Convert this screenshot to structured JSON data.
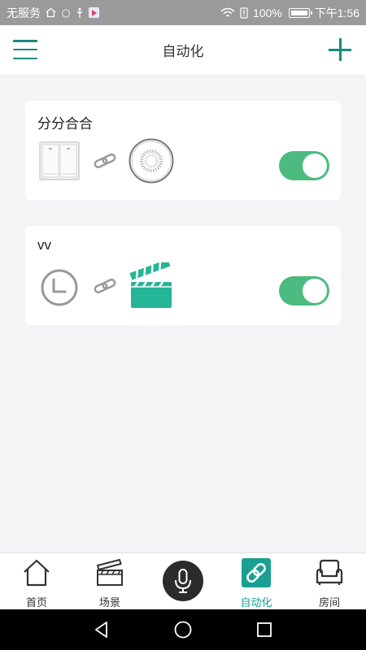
{
  "status_bar": {
    "carrier": "无服务",
    "battery": "100%",
    "time": "下午1:56"
  },
  "header": {
    "title": "自动化",
    "menu_icon": "menu-icon",
    "add_icon": "plus-icon"
  },
  "automations": [
    {
      "name": "分分合合",
      "trigger_icon": "wall-switch-icon",
      "link_icon": "link-icon",
      "action_icon": "speaker-device-icon",
      "enabled": true
    },
    {
      "name": "vv",
      "trigger_icon": "clock-icon",
      "link_icon": "link-icon",
      "action_icon": "clapperboard-scene-icon",
      "enabled": true
    }
  ],
  "bottom_nav": {
    "items": [
      {
        "label": "首页",
        "icon": "home-icon"
      },
      {
        "label": "场景",
        "icon": "clapperboard-icon"
      },
      {
        "label": "",
        "icon": "microphone-icon"
      },
      {
        "label": "自动化",
        "icon": "link-icon",
        "active": true
      },
      {
        "label": "房间",
        "icon": "sofa-icon"
      }
    ]
  },
  "colors": {
    "accent": "#1aa092",
    "toggle_on": "#4dbb7f",
    "background": "#f4f4f6"
  }
}
